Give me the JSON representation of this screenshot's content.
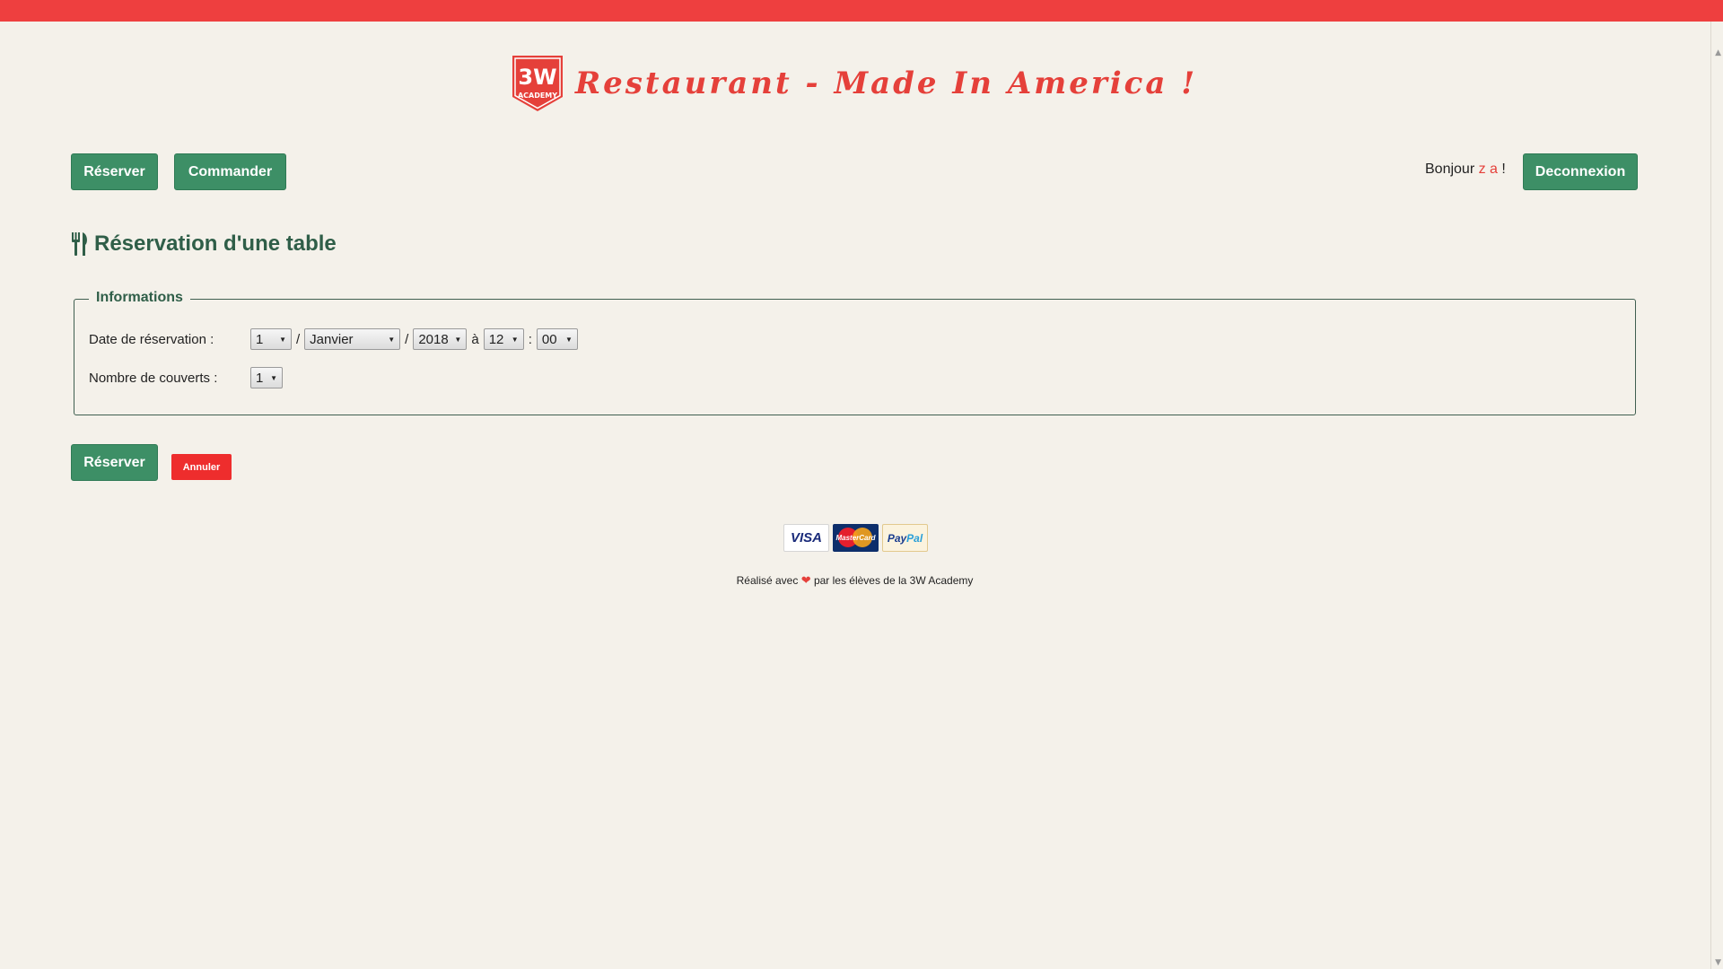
{
  "header": {
    "logo": {
      "top": "3W",
      "bottom": "ACADEMY"
    },
    "title": "Restaurant - Made In America !"
  },
  "nav": {
    "reserve_label": "Réserver",
    "order_label": "Commander",
    "greeting_prefix": "Bonjour",
    "username": "z a",
    "greeting_suffix": "!",
    "logout_label": "Deconnexion"
  },
  "section": {
    "icon": "cutlery-icon",
    "title": "Réservation d'une table"
  },
  "form": {
    "legend": "Informations",
    "date_label": "Date de réservation :",
    "day": "1",
    "month": "Janvier",
    "year": "2018",
    "at": "à",
    "hour": "12",
    "minute": "00",
    "date_sep": "/",
    "time_sep": ":",
    "covers_label": "Nombre de couverts :",
    "covers": "1",
    "submit_label": "Réserver",
    "cancel_label": "Annuler"
  },
  "footer": {
    "payments": [
      "VISA",
      "MasterCard",
      "PayPal"
    ],
    "credits_prefix": "Réalisé avec",
    "credits_suffix": "par les élèves de la 3W Academy"
  },
  "colors": {
    "topbar": "#ee3f3f",
    "accent_red": "#e5403a",
    "button_green": "#3d8f66",
    "title_green": "#2f5e48",
    "background": "#f4f1ea"
  }
}
